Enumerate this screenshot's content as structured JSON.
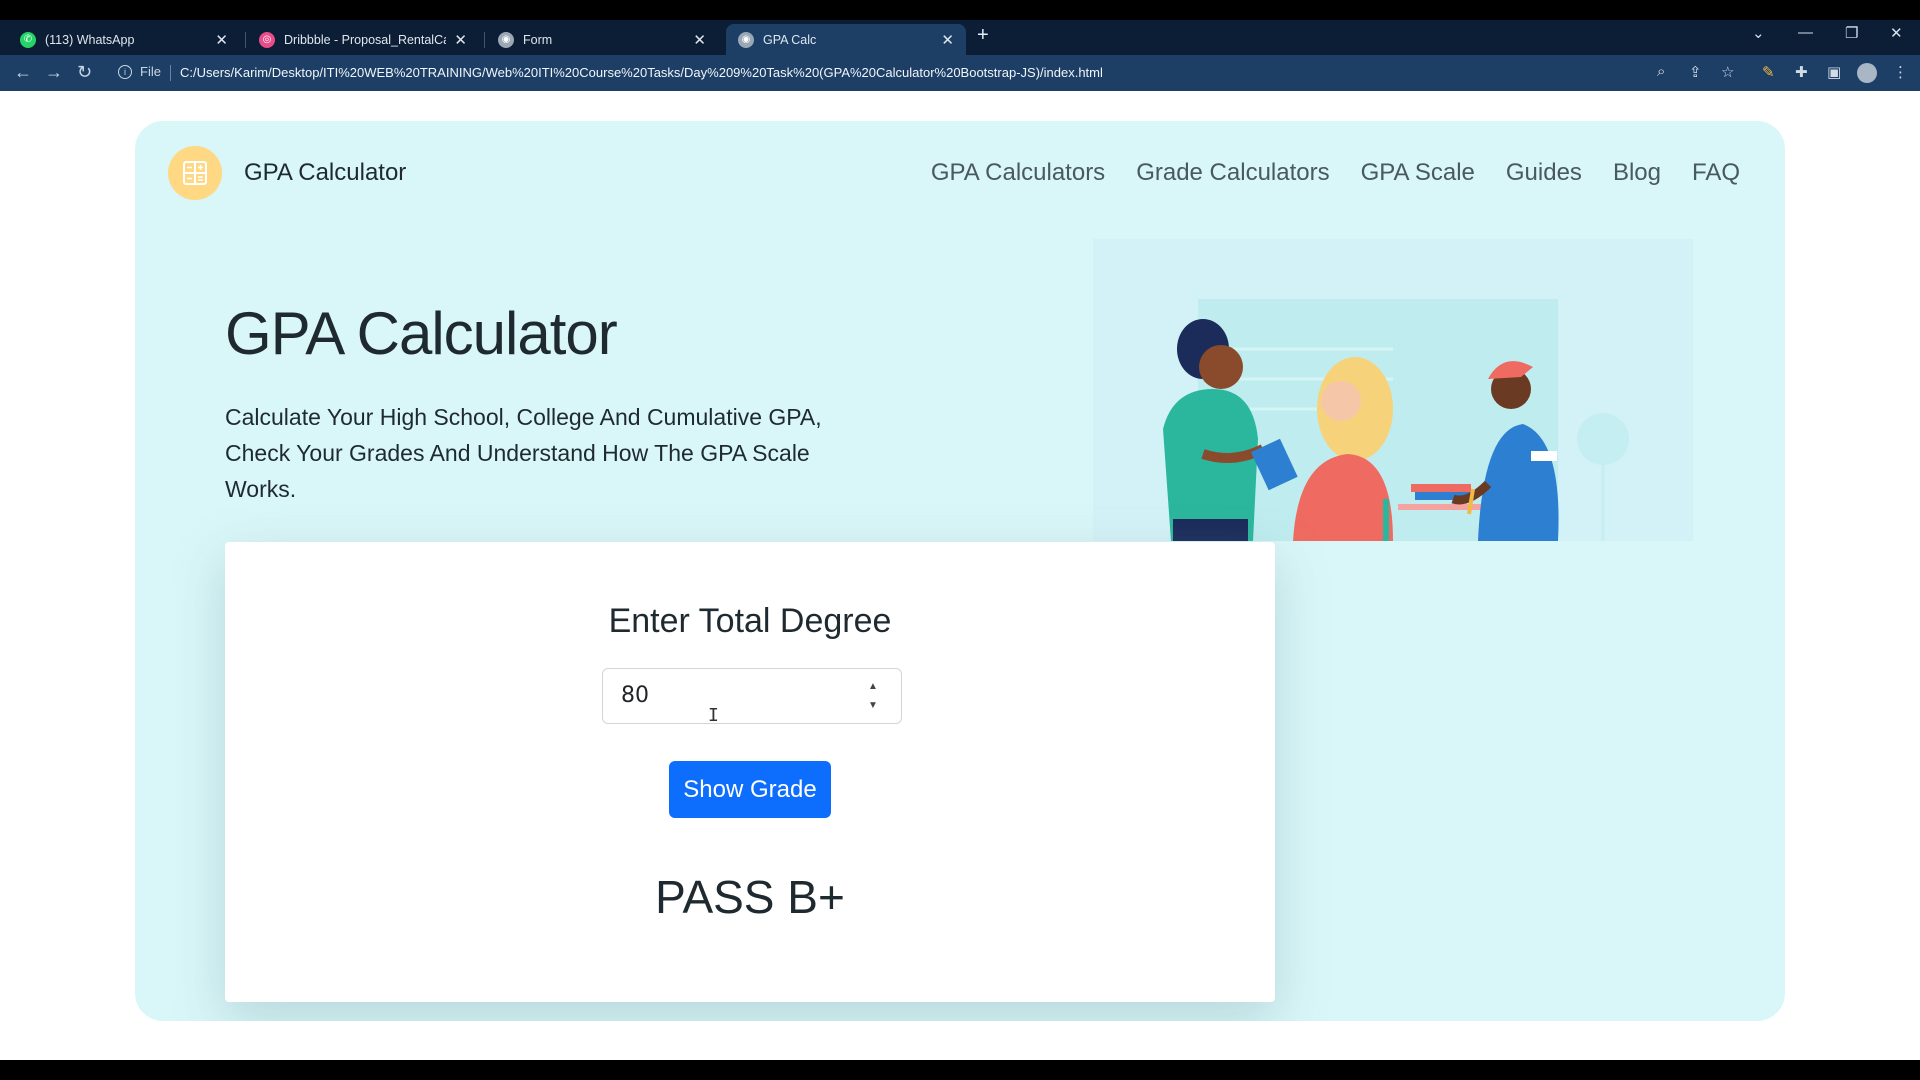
{
  "browser": {
    "tabs": [
      {
        "title": "(113) WhatsApp",
        "icon": "whatsapp-icon",
        "color": "#25d366",
        "active": false
      },
      {
        "title": "Dribbble - Proposal_RentalCar.pr",
        "icon": "dribbble-icon",
        "color": "#ea4c89",
        "active": false
      },
      {
        "title": "Form",
        "icon": "globe-icon",
        "color": "#9aa7b5",
        "active": false
      },
      {
        "title": "GPA Calc",
        "icon": "globe-icon",
        "color": "#9aa7b5",
        "active": true
      }
    ],
    "file_label": "File",
    "url": "C:/Users/Karim/Desktop/ITI%20WEB%20TRAINING/Web%20ITI%20Course%20Tasks/Day%209%20Task%20(GPA%20Calculator%20Bootstrap-JS)/index.html"
  },
  "page": {
    "brand": "GPA Calculator",
    "nav": [
      "GPA Calculators",
      "Grade Calculators",
      "GPA Scale",
      "Guides",
      "Blog",
      "FAQ"
    ],
    "heading": "GPA Calculator",
    "lead": "Calculate Your High School, College And Cumulative GPA, Check Your Grades And Understand How The GPA Scale Works.",
    "form": {
      "title": "Enter Total Degree",
      "value": "80",
      "button": "Show Grade",
      "result": "PASS B+"
    }
  },
  "colors": {
    "hero_bg": "#d9f6f8",
    "primary": "#0d6efd",
    "logo_bg": "#ffd884"
  }
}
